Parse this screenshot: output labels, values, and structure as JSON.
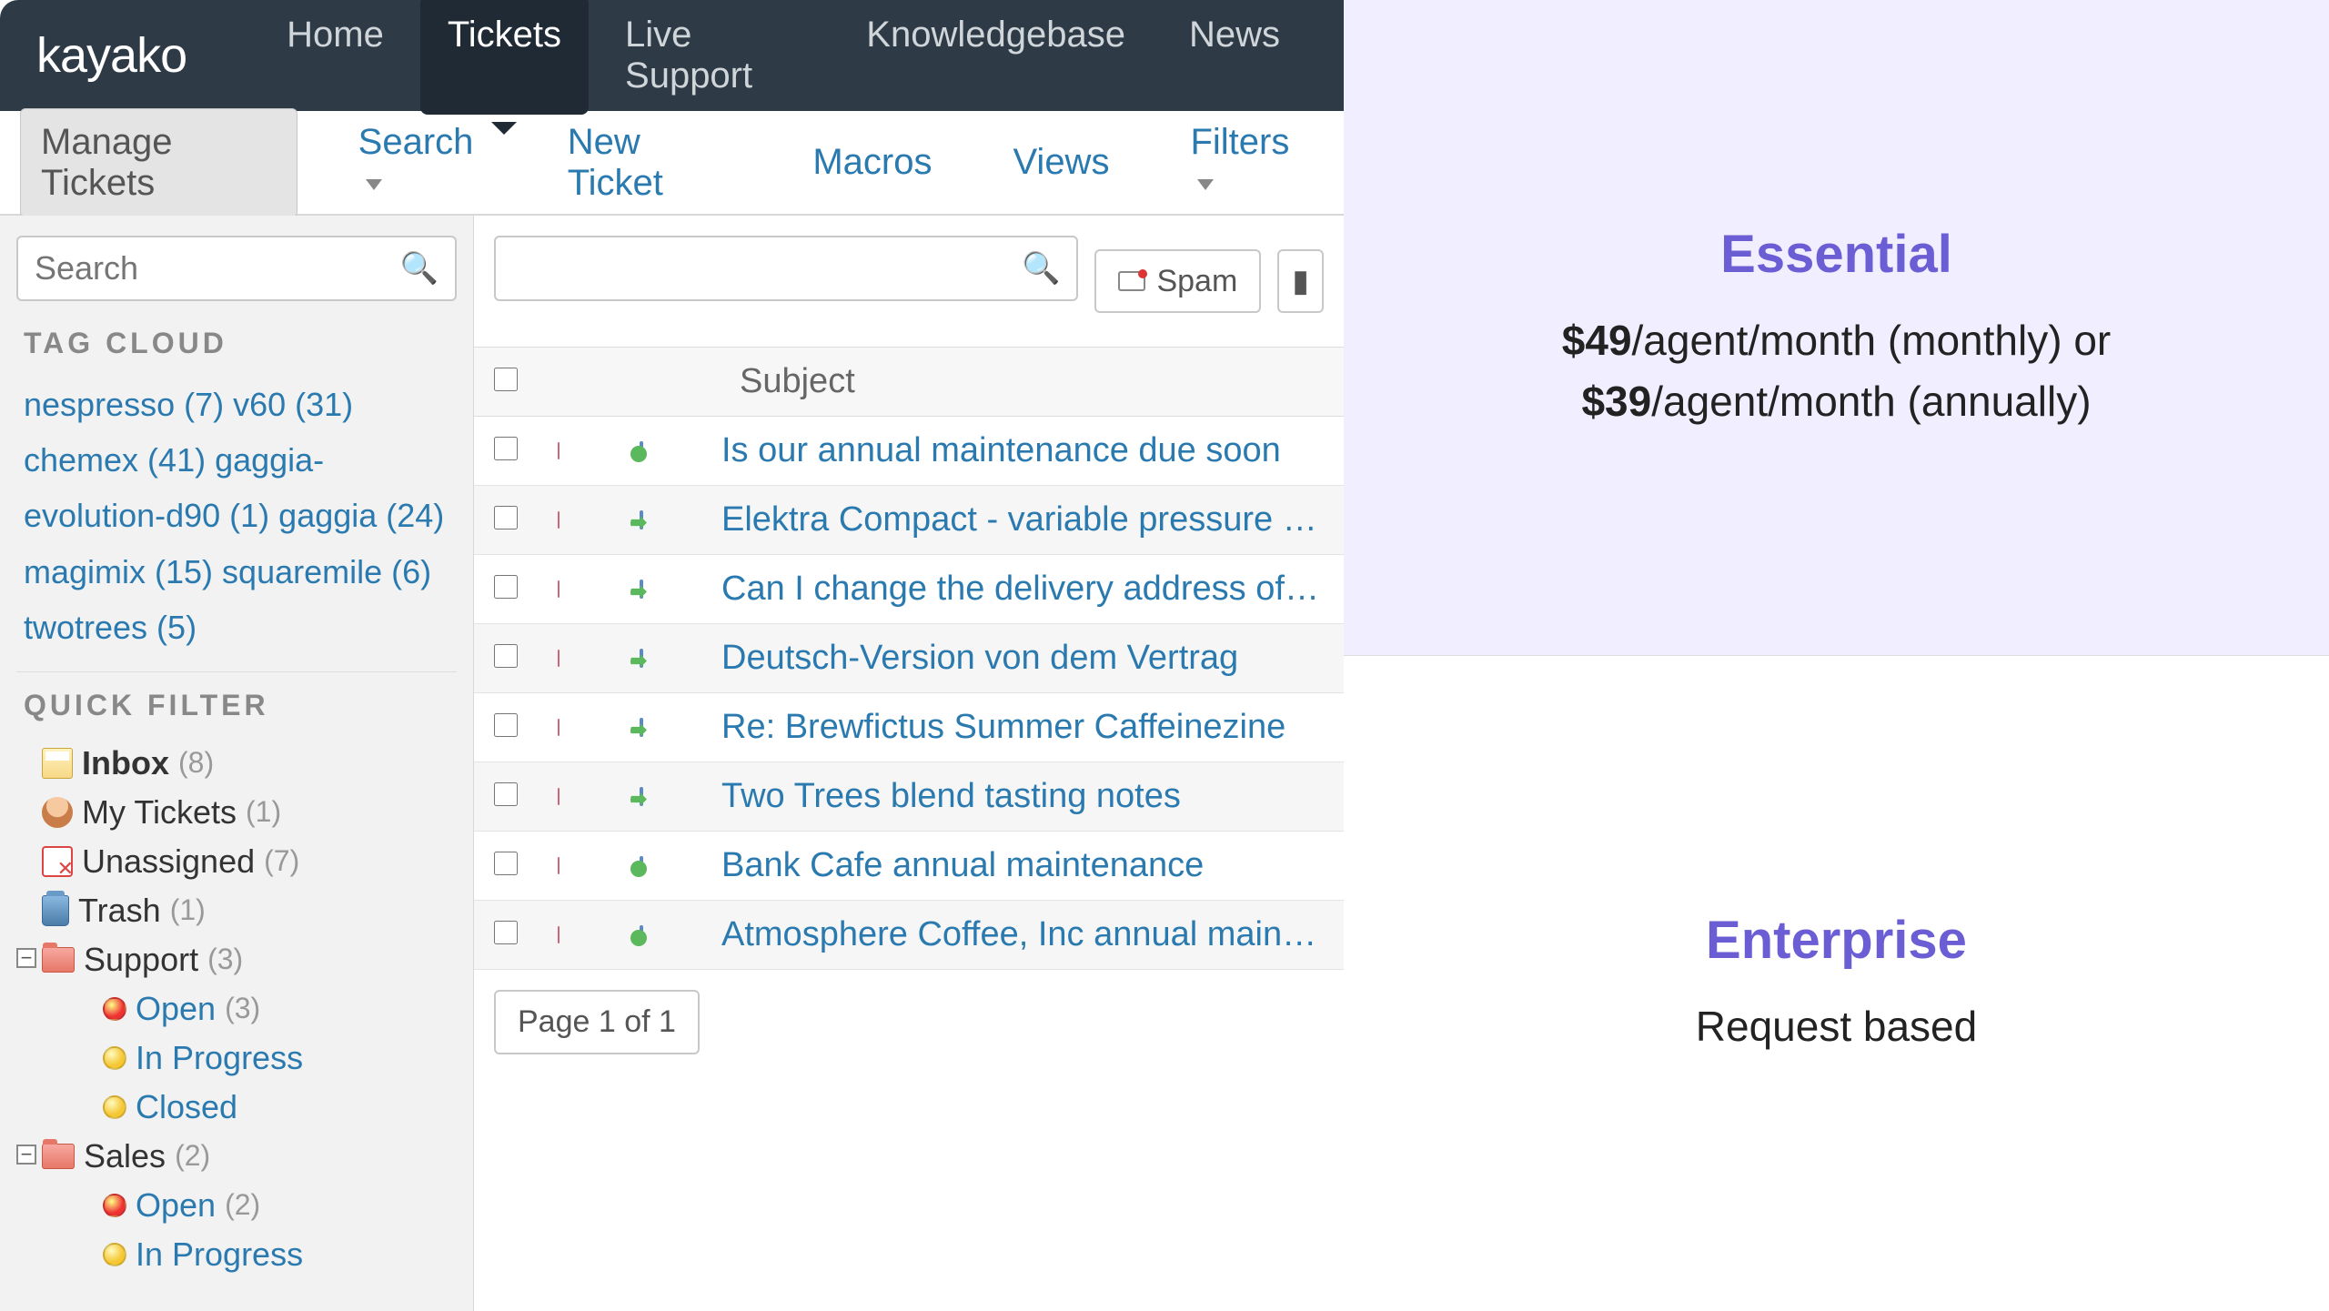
{
  "logo": "kayako",
  "topnav": [
    {
      "label": "Home",
      "active": false
    },
    {
      "label": "Tickets",
      "active": true
    },
    {
      "label": "Live Support",
      "active": false
    },
    {
      "label": "Knowledgebase",
      "active": false
    },
    {
      "label": "News",
      "active": false
    }
  ],
  "subnav": {
    "manage": "Manage Tickets",
    "search": "Search",
    "new_ticket": "New Ticket",
    "macros": "Macros",
    "views": "Views",
    "filters": "Filters"
  },
  "sidebar": {
    "search_placeholder": "Search",
    "tag_cloud_title": "TAG CLOUD",
    "tags": [
      {
        "name": "nespresso",
        "count": 7
      },
      {
        "name": "v60",
        "count": 31
      },
      {
        "name": "chemex",
        "count": 41
      },
      {
        "name": "gaggia-evolution-d90",
        "count": 1
      },
      {
        "name": "gaggia",
        "count": 24
      },
      {
        "name": "magimix",
        "count": 15
      },
      {
        "name": "squaremile",
        "count": 6
      },
      {
        "name": "twotrees",
        "count": 5
      }
    ],
    "quick_filter_title": "QUICK FILTER",
    "filters": {
      "inbox": {
        "label": "Inbox",
        "count": 8
      },
      "my_tickets": {
        "label": "My Tickets",
        "count": 1
      },
      "unassigned": {
        "label": "Unassigned",
        "count": 7
      },
      "trash": {
        "label": "Trash",
        "count": 1
      },
      "support": {
        "label": "Support",
        "count": 3,
        "children": [
          {
            "label": "Open",
            "count": 3,
            "color": "red"
          },
          {
            "label": "In Progress",
            "count": null,
            "color": "yellow"
          },
          {
            "label": "Closed",
            "count": null,
            "color": "yellow"
          }
        ]
      },
      "sales": {
        "label": "Sales",
        "count": 2,
        "children": [
          {
            "label": "Open",
            "count": 2,
            "color": "red"
          },
          {
            "label": "In Progress",
            "count": null,
            "color": "yellow"
          }
        ]
      }
    }
  },
  "main": {
    "spam_button": "Spam",
    "table_header": {
      "subject": "Subject"
    },
    "tickets": [
      {
        "subject": "Is our annual maintenance due soon",
        "status": "check"
      },
      {
        "subject": "Elektra Compact - variable pressure supp",
        "status": "arrow"
      },
      {
        "subject": "Can I change the delivery address of my",
        "status": "arrow"
      },
      {
        "subject": "Deutsch-Version von dem Vertrag",
        "status": "arrow"
      },
      {
        "subject": "Re: Brewfictus Summer Caffeinezine",
        "status": "arrow"
      },
      {
        "subject": "Two Trees blend tasting notes",
        "status": "arrow"
      },
      {
        "subject": "Bank Cafe annual maintenance",
        "status": "check"
      },
      {
        "subject": "Atmosphere Coffee, Inc annual maintenan",
        "status": "check"
      }
    ],
    "pagination": "Page 1 of 1"
  },
  "pricing": {
    "essential": {
      "title": "Essential",
      "price1": "$49",
      "suffix1": "/agent/month (monthly) or",
      "price2": "$39",
      "suffix2": "/agent/month (annually)"
    },
    "enterprise": {
      "title": "Enterprise",
      "detail": "Request based"
    }
  }
}
